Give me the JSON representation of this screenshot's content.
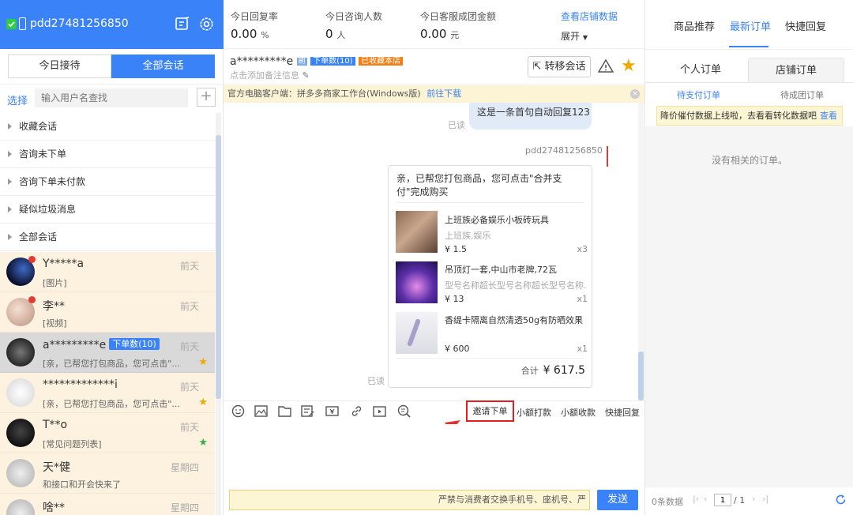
{
  "account": {
    "name": "pdd27481256850"
  },
  "left_tabs": {
    "today": "今日接待",
    "all": "全部会话"
  },
  "search": {
    "select_label": "选择",
    "placeholder": "输入用户名查找",
    "add": "+"
  },
  "groups": [
    "收藏会话",
    "咨询未下单",
    "咨询下单未付款",
    "疑似垃圾消息",
    "全部会话"
  ],
  "conversations": [
    {
      "name": "Y*****a",
      "preview": "[图片]",
      "time": "前天"
    },
    {
      "name": "李**",
      "preview": "[视频]",
      "time": "前天"
    },
    {
      "name": "a*********e",
      "badge": "下单数(10)",
      "preview": "[亲，已帮您打包商品，您可点击\"...",
      "time": "前天"
    },
    {
      "name": "*************i",
      "preview": "[亲，已帮您打包商品，您可点击\"...",
      "time": "前天"
    },
    {
      "name": "T**o",
      "preview": "[常见问题列表]",
      "time": "前天"
    },
    {
      "name": "天*健",
      "preview": "和接口和开会快来了",
      "time": "星期四"
    },
    {
      "name": "啥**",
      "preview": "",
      "time": "星期四"
    }
  ],
  "stats": [
    {
      "label": "今日回复率",
      "value": "0.00",
      "unit": "%"
    },
    {
      "label": "今日咨询人数",
      "value": "0",
      "unit": "人"
    },
    {
      "label": "今日客服成团金额",
      "value": "0.00",
      "unit": "元"
    }
  ],
  "store_link": "查看店铺数据",
  "expand": "展开",
  "chat": {
    "user": "a*********e",
    "tag_small": "刷",
    "tag_orders": "下单数(10)",
    "tag_fav": "已收藏本店",
    "note": "点击添加备注信息",
    "transfer": "转移会话",
    "banner": "官方电脑客户端：拼多多商家工作台(Windows版)",
    "banner_link": "前往下载",
    "read": "已读",
    "auto_reply": "这是一条首句自动回复123",
    "sender": "pdd27481256850",
    "card_title": "亲，已帮您打包商品，您可点击\"合并支付\"完成购买",
    "items": [
      {
        "title": "上班族必备娱乐小板砖玩具",
        "spec": "上班族,娱乐",
        "price": "¥ 1.5",
        "qty": "x3"
      },
      {
        "title": "吊顶灯一套,中山市老牌,72瓦",
        "spec": "型号名称超长型号名称超长型号名称...",
        "price": "¥ 13",
        "qty": "x1"
      },
      {
        "title": "香缇卡隔离自然清透50g有防晒效果",
        "spec": "",
        "price": "¥ 600",
        "qty": "x1"
      }
    ],
    "total_label": "合计",
    "total": "¥ 617.5",
    "read2": "已读",
    "tools": {
      "invite": "邀请下单",
      "small_pay": "小额打款",
      "small_collect": "小额收款",
      "quick": "快捷回复"
    },
    "warn": "严禁与消费者交换手机号、座机号、严",
    "send": "发送"
  },
  "right": {
    "tabs": [
      "商品推荐",
      "最新订单",
      "快捷回复"
    ],
    "sub_tabs": [
      "个人订单",
      "店铺订单"
    ],
    "order_tabs": [
      "待支付订单",
      "待成团订单"
    ],
    "notice": "降价催付数据上线啦，去看看转化数据吧",
    "notice_link": "查看",
    "empty": "没有相关的订单。",
    "count": "0条数据",
    "page": "1",
    "pages": "/ 1"
  }
}
